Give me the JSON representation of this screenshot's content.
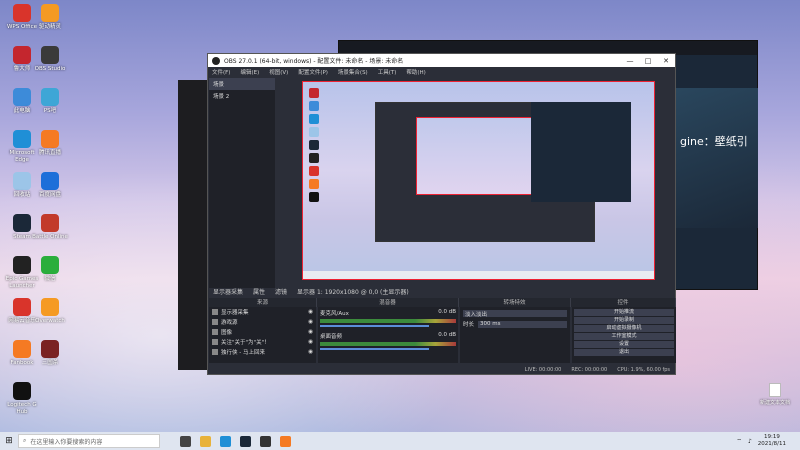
{
  "desktop_icons": [
    {
      "label": "WPS Office",
      "color": "#d9342b"
    },
    {
      "label": "驱动精灵",
      "color": "#f59a23"
    },
    {
      "label": "鲁大师",
      "color": "#c4262e"
    },
    {
      "label": "OBS Studio",
      "color": "#3a3a3a"
    },
    {
      "label": "此电脑",
      "color": "#3d8bd9"
    },
    {
      "label": "PS吧",
      "color": "#3ea6d6"
    },
    {
      "label": "Microsoft Edge",
      "color": "#1f8fd6"
    },
    {
      "label": "腾讯直播",
      "color": "#f57a23"
    },
    {
      "label": "回收站",
      "color": "#9cc5e8"
    },
    {
      "label": "百度网盘",
      "color": "#1d6fd9"
    },
    {
      "label": "Steam",
      "color": "#1b2838"
    },
    {
      "label": "Battle Online",
      "color": "#c23a2a"
    },
    {
      "label": "Epic Games Launcher",
      "color": "#222222"
    },
    {
      "label": "微信",
      "color": "#2aae3c"
    },
    {
      "label": "网易云音乐",
      "color": "#d9342b"
    },
    {
      "label": "Overwatch",
      "color": "#f59a23"
    },
    {
      "label": "Fanbook",
      "color": "#f57a23"
    },
    {
      "label": "三国杀",
      "color": "#7a2222"
    },
    {
      "label": "Logitech G Hub",
      "color": "#111111"
    }
  ],
  "steam": {
    "banner_text": "gine：壁纸引"
  },
  "obs": {
    "title": "OBS 27.0.1 (64-bit, windows) - 配置文件: 未命名 - 场景: 未命名",
    "menu": [
      "文件(F)",
      "编辑(E)",
      "视图(V)",
      "配置文件(P)",
      "场景集合(S)",
      "工具(T)",
      "帮助(H)"
    ],
    "scenes": [
      "场景",
      "场景 2"
    ],
    "scene_selected": "场景",
    "controls_bar": [
      "显示器采集",
      "属性",
      "滤镜",
      "显示器 1: 1920x1080 @ 0,0 (主显示器)"
    ],
    "dock_headers": [
      "来源",
      "混音器",
      "转场特效",
      "控件"
    ],
    "sources": [
      "显示器采集",
      "游戏源",
      "图像",
      "关注\"关于\"为\"关\"！",
      "独行侠 - 马上回来"
    ],
    "mixer": [
      {
        "name": "麦克风/Aux",
        "db": "0.0 dB"
      },
      {
        "name": "桌面音频",
        "db": "0.0 dB"
      }
    ],
    "transition": {
      "label": "淡入淡出",
      "duration_label": "时长",
      "duration": "300 ms"
    },
    "control_buttons": [
      "开始推流",
      "开始录制",
      "启动虚拟摄像机",
      "工作室模式",
      "设置",
      "退出"
    ],
    "status": {
      "live": "LIVE: 00:00:00",
      "rec": "REC: 00:00:00",
      "cpu": "CPU: 1.9%, 60.00 fps"
    }
  },
  "taskbar": {
    "search_placeholder": "在这里输入你要搜索的内容",
    "time": "19:19",
    "date": "2021/8/11"
  },
  "file_icon_label": "新建文本文档"
}
